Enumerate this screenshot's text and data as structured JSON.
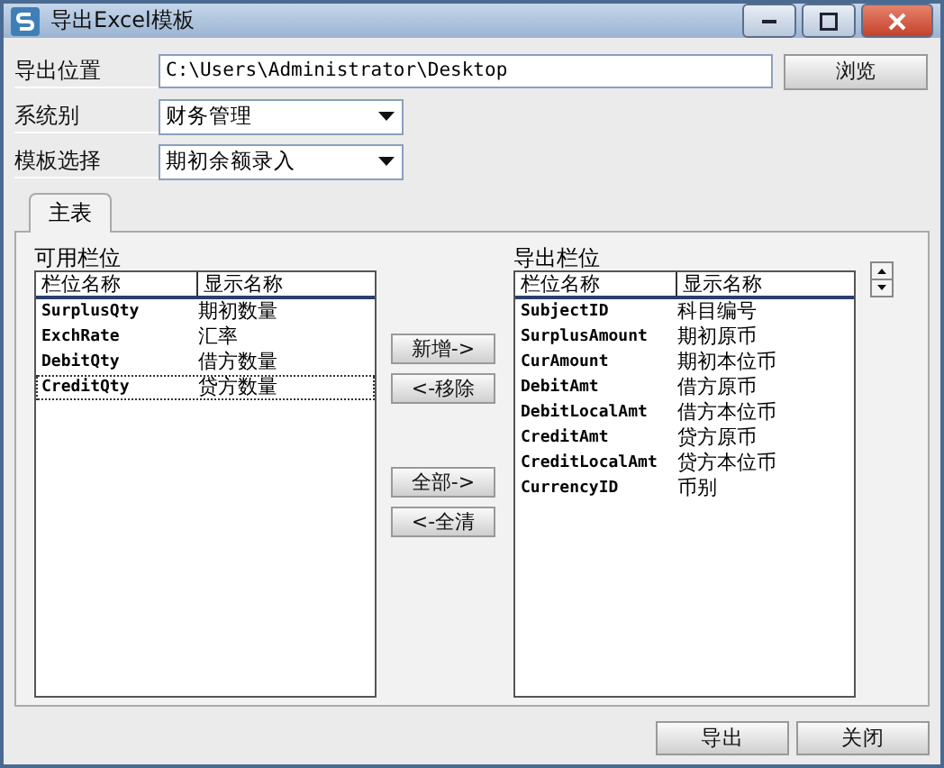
{
  "window": {
    "title": "导出Excel模板"
  },
  "form": [
    {
      "kind": "text",
      "label": "导出位置",
      "value": "C:\\Users\\Administrator\\Desktop",
      "button": "浏览"
    },
    {
      "kind": "select",
      "label": "系统别",
      "value": "财务管理"
    },
    {
      "kind": "select",
      "label": "模板选择",
      "value": "期初余额录入"
    }
  ],
  "tabs": [
    {
      "label": "主表",
      "selected": true
    }
  ],
  "available": {
    "title": "可用栏位",
    "columns": [
      "栏位名称",
      "显示名称"
    ],
    "rows": [
      {
        "field": "SurplusQty",
        "display": "期初数量",
        "selected": false
      },
      {
        "field": "ExchRate",
        "display": "汇率",
        "selected": false
      },
      {
        "field": "DebitQty",
        "display": "借方数量",
        "selected": false
      },
      {
        "field": "CreditQty",
        "display": "贷方数量",
        "selected": true
      }
    ]
  },
  "move_buttons": [
    "新增->",
    "<-移除",
    "全部->",
    "<-全清"
  ],
  "exported": {
    "title": "导出栏位",
    "columns": [
      "栏位名称",
      "显示名称"
    ],
    "rows": [
      {
        "field": "SubjectID",
        "display": "科目编号",
        "selected": false
      },
      {
        "field": "SurplusAmount",
        "display": "期初原币",
        "selected": false
      },
      {
        "field": "CurAmount",
        "display": "期初本位币",
        "selected": false
      },
      {
        "field": "DebitAmt",
        "display": "借方原币",
        "selected": false
      },
      {
        "field": "DebitLocalAmt",
        "display": "借方本位币",
        "selected": false
      },
      {
        "field": "CreditAmt",
        "display": "贷方原币",
        "selected": false
      },
      {
        "field": "CreditLocalAmt",
        "display": "贷方本位币",
        "selected": false
      },
      {
        "field": "CurrencyID",
        "display": "币别",
        "selected": false
      }
    ]
  },
  "buttons": [
    "导出",
    "关闭"
  ]
}
